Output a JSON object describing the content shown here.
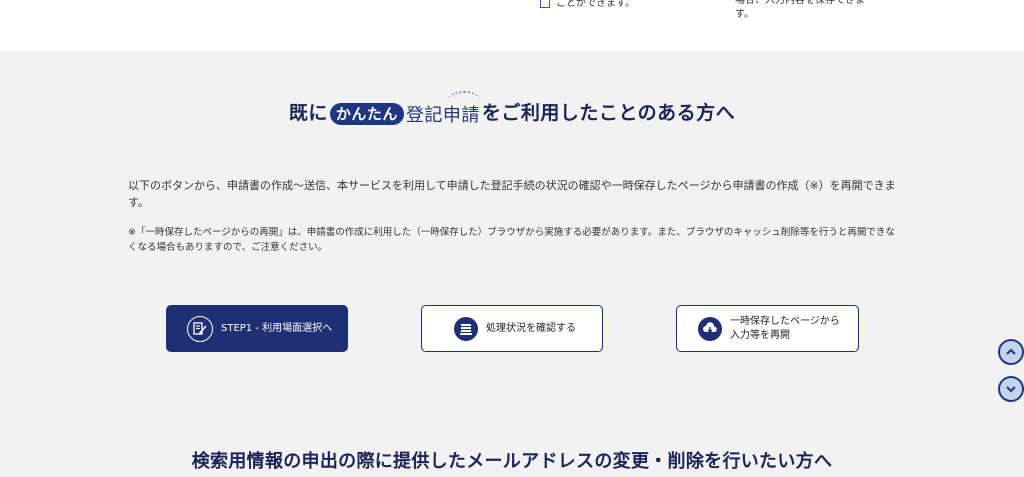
{
  "top_fragment": {
    "left_text": "ことができます。",
    "right_text_1": "場合、入力内容を保存できま",
    "right_text_2": "す。"
  },
  "hero": {
    "prefix": "既に",
    "logo_pill": "かんたん",
    "logo_rest": "登記申請",
    "suffix": "をご利用したことのある方へ"
  },
  "intro_text": "以下のボタンから、申請書の作成～送信、本サービスを利用して申請した登記手続の状況の確認や一時保存したページから申請書の作成（※）を再開できます。",
  "note_text": "※「一時保存したページからの再開」は、申請書の作成に利用した（一時保存した）ブラウザから実施する必要があります。また、ブラウザのキャッシュ削除等を行うと再開できなくなる場合もありますので、ご注意ください。",
  "buttons": {
    "step1": {
      "label": "STEP1 - 利用場面選択へ",
      "icon": "edit-document-icon"
    },
    "status": {
      "label": "処理状況を確認する",
      "icon": "document-tray-icon"
    },
    "resume": {
      "label_line1": "一時保存したページから",
      "label_line2": "入力等を再開",
      "icon": "cloud-download-icon"
    }
  },
  "scroll": {
    "up_icon": "chevron-up-icon",
    "down_icon": "chevron-down-icon"
  },
  "section2_title": "検索用情報の申出の際に提供したメールアドレスの変更・削除を行いたい方へ",
  "colors": {
    "navy": "#1f2f73",
    "title": "#1a2456",
    "background": "#f2f2f2",
    "scroll_fill": "#c4d4ec"
  }
}
